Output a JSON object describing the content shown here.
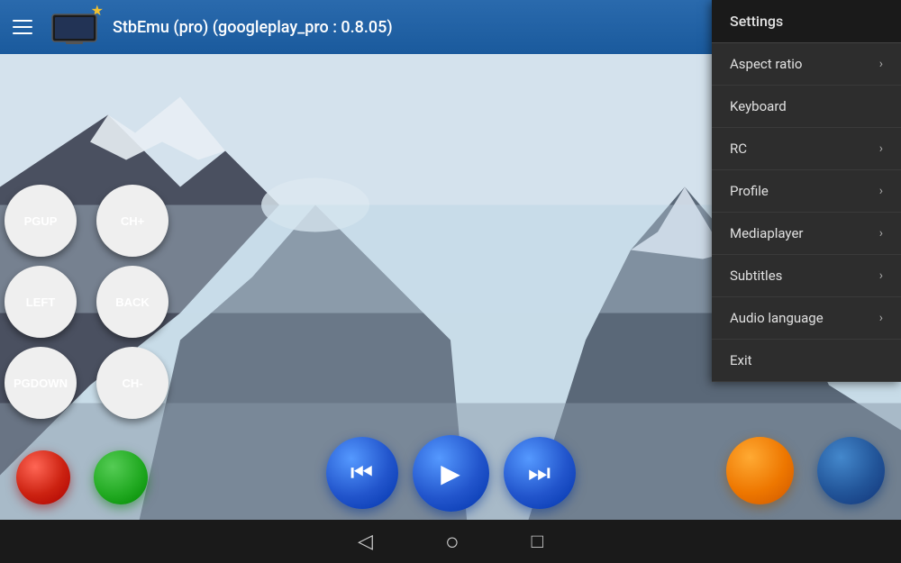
{
  "app": {
    "title": "StbEmu (pro) (googleplay_pro : 0.8.05)"
  },
  "topbar": {
    "hamburger_label": "menu",
    "star": "★"
  },
  "menu": {
    "header": "Settings",
    "items": [
      {
        "id": "aspect-ratio",
        "label": "Aspect ratio",
        "has_arrow": true
      },
      {
        "id": "keyboard",
        "label": "Keyboard",
        "has_arrow": false
      },
      {
        "id": "rc",
        "label": "RC",
        "has_arrow": true
      },
      {
        "id": "profile",
        "label": "Profile",
        "has_arrow": true
      },
      {
        "id": "mediaplayer",
        "label": "Mediaplayer",
        "has_arrow": true
      },
      {
        "id": "subtitles",
        "label": "Subtitles",
        "has_arrow": true
      },
      {
        "id": "audio-language",
        "label": "Audio language",
        "has_arrow": true
      },
      {
        "id": "exit",
        "label": "Exit",
        "has_arrow": false
      }
    ]
  },
  "controls": {
    "buttons_row1": [
      {
        "id": "pgup",
        "label": "PGUP"
      },
      {
        "id": "chplus",
        "label": "CH+"
      }
    ],
    "buttons_row2": [
      {
        "id": "left",
        "label": "LEFT"
      },
      {
        "id": "back",
        "label": "BACK"
      }
    ],
    "buttons_row3": [
      {
        "id": "pgdown",
        "label": "PGDOWN"
      },
      {
        "id": "chminus",
        "label": "CH-"
      }
    ]
  },
  "media_buttons": {
    "rewind": "⏮",
    "play": "▶",
    "forward": "⏭"
  },
  "navbar": {
    "back_icon": "◁",
    "home_icon": "○",
    "square_icon": "□"
  },
  "colors": {
    "topbar_bg": "#2266aa",
    "menu_bg": "#2d2d2d",
    "menu_header_bg": "#1a1a1a",
    "btn_blue": "#2266bb"
  }
}
